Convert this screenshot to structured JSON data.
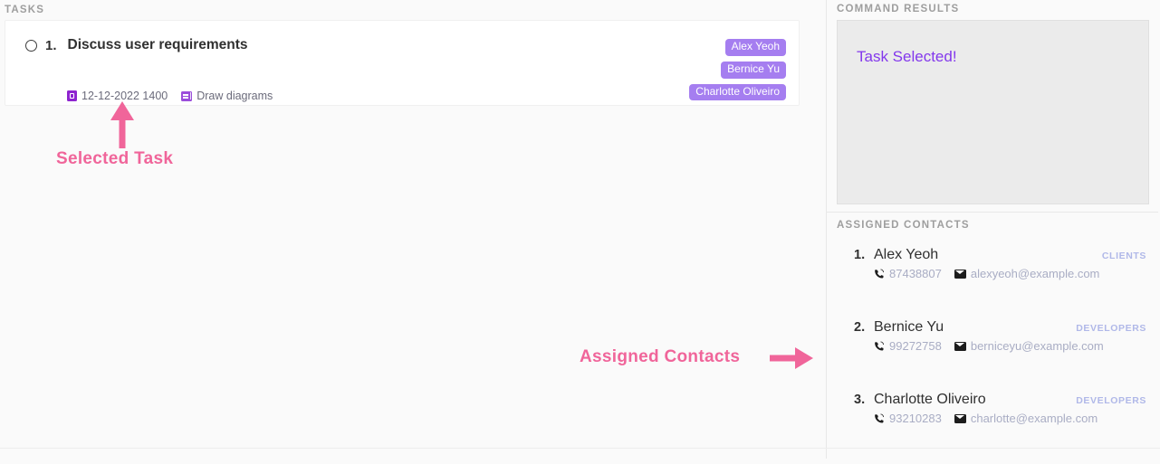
{
  "tasks_panel": {
    "header": "TASKS",
    "task": {
      "index": "1.",
      "title": "Discuss user requirements",
      "checkbox_state": "unchecked",
      "date_icon": "calendar-icon",
      "date": "12-12-2022 1400",
      "note_icon": "note-icon",
      "description": "Draw diagrams",
      "tags": [
        "Alex Yeoh",
        "Bernice Yu",
        "Charlotte Oliveiro"
      ],
      "tag_bg_color": "#a57ef0",
      "tag_text_color": "#ffffff"
    }
  },
  "annotations": {
    "selected_task": "Selected Task",
    "assigned_contacts": "Assigned Contacts",
    "color": "#f0659a",
    "arrow_up_icon": "arrow-up-icon",
    "arrow_right_icon": "arrow-right-icon"
  },
  "command_results": {
    "header": "COMMAND RESULTS",
    "message": "Task Selected!",
    "message_color": "#8338ec",
    "panel_bg": "#ebebeb"
  },
  "assigned_contacts": {
    "header": "ASSIGNED CONTACTS",
    "contacts": [
      {
        "index": "1.",
        "name": "Alex Yeoh",
        "tag": "CLIENTS",
        "phone_icon": "phone-icon",
        "phone": "87438807",
        "email_icon": "envelope-icon",
        "email": "alexyeoh@example.com"
      },
      {
        "index": "2.",
        "name": "Bernice Yu",
        "tag": "DEVELOPERS",
        "phone_icon": "phone-icon",
        "phone": "99272758",
        "email_icon": "envelope-icon",
        "email": "berniceyu@example.com"
      },
      {
        "index": "3.",
        "name": "Charlotte Oliveiro",
        "tag": "DEVELOPERS",
        "phone_icon": "phone-icon",
        "phone": "93210283",
        "email_icon": "envelope-icon",
        "email": "charlotte@example.com"
      }
    ]
  }
}
